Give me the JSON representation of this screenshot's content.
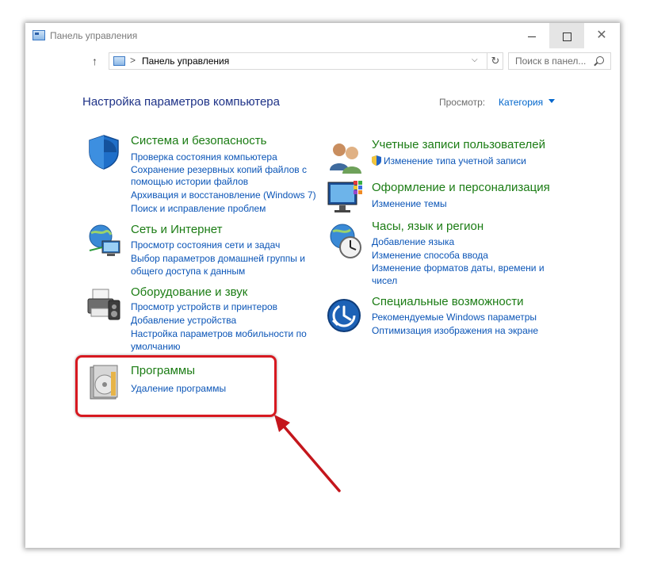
{
  "window": {
    "title": "Панель управления"
  },
  "address_bar": {
    "path": "Панель управления",
    "separator": ">",
    "search_placeholder": "Поиск в панел..."
  },
  "main": {
    "heading": "Настройка параметров компьютера",
    "view_label": "Просмотр:",
    "view_value": "Категория"
  },
  "categories": {
    "system": {
      "title": "Система и безопасность",
      "links": [
        "Проверка состояния компьютера",
        "Сохранение резервных копий файлов с",
        "помощью истории файлов",
        "Архивация и восстановление (Windows 7)",
        "Поиск и исправление проблем"
      ]
    },
    "network": {
      "title": "Сеть и Интернет",
      "links": [
        "Просмотр состояния сети и задач",
        "Выбор параметров домашней группы и",
        "общего доступа к данным"
      ]
    },
    "hardware": {
      "title": "Оборудование и звук",
      "links": [
        "Просмотр устройств и принтеров",
        "Добавление устройства",
        "Настройка параметров мобильности по",
        "умолчанию"
      ]
    },
    "programs": {
      "title": "Программы",
      "links": [
        "Удаление программы"
      ]
    },
    "accounts": {
      "title": "Учетные записи пользователей",
      "links": [
        "Изменение типа учетной записи"
      ]
    },
    "appearance": {
      "title": "Оформление и персонализация",
      "links": [
        "Изменение темы"
      ]
    },
    "clock": {
      "title": "Часы, язык и регион",
      "links": [
        "Добавление языка",
        "Изменение способа ввода",
        "Изменение форматов даты, времени и",
        "чисел"
      ]
    },
    "access": {
      "title": "Специальные возможности",
      "links": [
        "Рекомендуемые Windows параметры",
        "Оптимизация изображения на экране"
      ]
    }
  },
  "colors": {
    "category_title": "#1b7c14",
    "link": "#0b55b7",
    "heading": "#1e3287",
    "highlight": "#d71920"
  }
}
